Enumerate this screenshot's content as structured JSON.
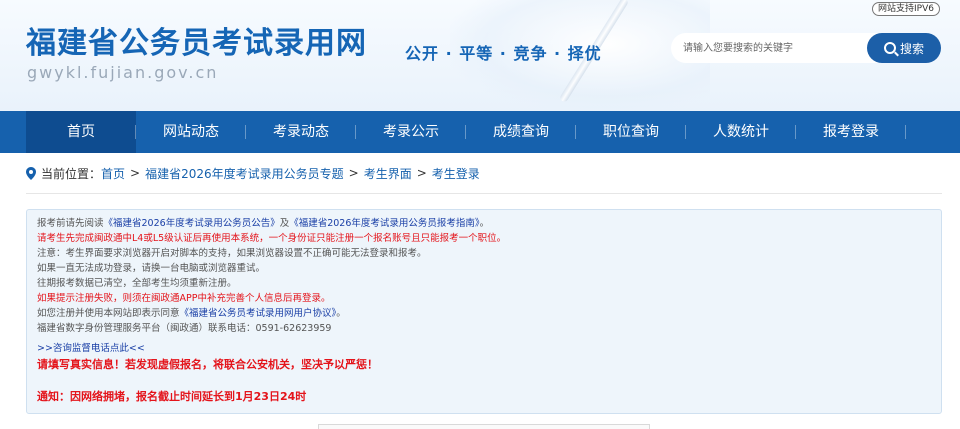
{
  "header": {
    "title": "福建省公务员考试录用网",
    "domain": "gwykl.fujian.gov.cn",
    "slogan": "公开 · 平等 · 竞争 · 择优",
    "ipv6_badge": "网站支持IPV6"
  },
  "search": {
    "placeholder": "请输入您要搜索的关键字",
    "button_label": "搜索"
  },
  "nav": {
    "items": [
      {
        "label": "首页"
      },
      {
        "label": "网站动态"
      },
      {
        "label": "考录动态"
      },
      {
        "label": "考录公示"
      },
      {
        "label": "成绩查询"
      },
      {
        "label": "职位查询"
      },
      {
        "label": "人数统计"
      },
      {
        "label": "报考登录"
      }
    ]
  },
  "breadcrumb": {
    "prefix": "当前位置：",
    "items": [
      "首页",
      "福建省2026年度考试录用公务员专题",
      "考生界面",
      "考生登录"
    ],
    "separator": ">"
  },
  "notice": {
    "line1_pre": "报考前请先阅读",
    "line1_link1": "《福建省2026年度考试录用公务员公告》",
    "line1_mid": "及",
    "line1_link2": "《福建省2026年度考试录用公务员报考指南》",
    "line1_post": "。",
    "line2": "请考生先完成闽政通中L4或L5级认证后再使用本系统，一个身份证只能注册一个报名账号且只能报考一个职位。",
    "line3": "注意：考生界面要求浏览器开启对脚本的支持，如果浏览器设置不正确可能无法登录和报考。",
    "line4": "如果一直无法成功登录，请换一台电脑或浏览器重试。",
    "line5": "往期报考数据已清空，全部考生均须重新注册。",
    "line6": "如果提示注册失败，则须在闽政通APP中补充完善个人信息后再登录。",
    "line7_pre": "如您注册并使用本网站即表示同意",
    "line7_link": "《福建省公务员考试录用网用户协议》",
    "line7_post": "。",
    "line8": "福建省数字身份管理服务平台（闽政通）联系电话：0591-62623959",
    "line9": ">>咨询监督电话点此<<",
    "line10": "请填写真实信息！若发现虚假报名，将联合公安机关，坚决予以严惩！",
    "line11": "通知：因网络拥堵，报名截止时间延长到1月23日24时"
  },
  "colors": {
    "brand_blue": "#1661ad",
    "nav_active": "#0e4c90",
    "warning_red": "#e4141b",
    "link_blue": "#1a3fa6"
  }
}
